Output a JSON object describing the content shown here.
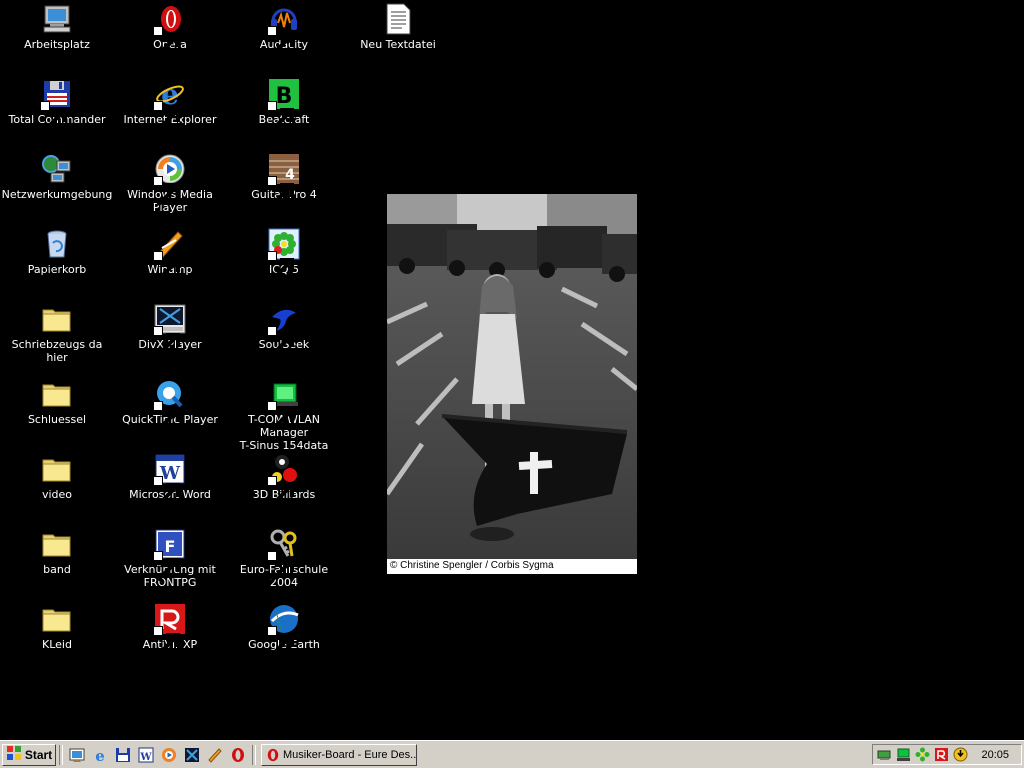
{
  "desktop": {
    "icons": [
      {
        "label": "Arbeitsplatz",
        "icon": "computer-icon"
      },
      {
        "label": "Total Commander",
        "icon": "floppy-disk-icon"
      },
      {
        "label": "Netzwerkumgebung",
        "icon": "network-icon"
      },
      {
        "label": "Papierkorb",
        "icon": "recycle-bin-icon"
      },
      {
        "label": "Schriebzeugs da hier",
        "icon": "folder-icon"
      },
      {
        "label": "Schluessel",
        "icon": "folder-icon"
      },
      {
        "label": "video",
        "icon": "folder-icon"
      },
      {
        "label": "band",
        "icon": "folder-icon"
      },
      {
        "label": "KLeid",
        "icon": "folder-icon"
      },
      {
        "label": "Opera",
        "icon": "opera-icon"
      },
      {
        "label": "Internet Explorer",
        "icon": "internet-explorer-icon"
      },
      {
        "label": "Windows Media Player",
        "icon": "media-player-icon"
      },
      {
        "label": "Winamp",
        "icon": "winamp-icon"
      },
      {
        "label": "DivX Player",
        "icon": "divx-icon"
      },
      {
        "label": "QuickTime Player",
        "icon": "quicktime-icon"
      },
      {
        "label": "Microsoft Word",
        "icon": "word-icon"
      },
      {
        "label": "Verknüpfung mit\nFRONTPG",
        "icon": "frontpage-icon"
      },
      {
        "label": "AntiVir XP",
        "icon": "antivir-icon"
      },
      {
        "label": "Audacity",
        "icon": "audacity-icon"
      },
      {
        "label": "Beatcraft",
        "icon": "beatcraft-icon"
      },
      {
        "label": "Guitar Pro 4",
        "icon": "guitar-pro-icon"
      },
      {
        "label": "ICQ 5",
        "icon": "icq-icon"
      },
      {
        "label": "SoulSeek",
        "icon": "soulseek-icon"
      },
      {
        "label": "T-COM WLAN Manager\nT-Sinus 154data",
        "icon": "wlan-manager-icon"
      },
      {
        "label": "3D Billiards",
        "icon": "billiards-icon"
      },
      {
        "label": "Euro-Fahrschule 2004",
        "icon": "keys-icon"
      },
      {
        "label": "Google Earth",
        "icon": "google-earth-icon"
      },
      {
        "label": "Neu Textdatei",
        "icon": "text-file-icon"
      }
    ]
  },
  "wallpaper": {
    "caption": "© Christine Spengler / Corbis Sygma"
  },
  "taskbar": {
    "start_label": "Start",
    "quick_launch": [
      "show-desktop-icon",
      "internet-explorer-icon",
      "floppy-disk-icon",
      "word-icon",
      "media-player-icon",
      "divx-icon",
      "winamp-icon",
      "opera-icon"
    ],
    "task_label": "Musiker-Board - Eure Des...",
    "tray_icons": [
      "usb-device-icon",
      "network-tray-icon",
      "icq-tray-icon",
      "antivir-tray-icon",
      "security-tray-icon"
    ],
    "clock": "20:05"
  }
}
